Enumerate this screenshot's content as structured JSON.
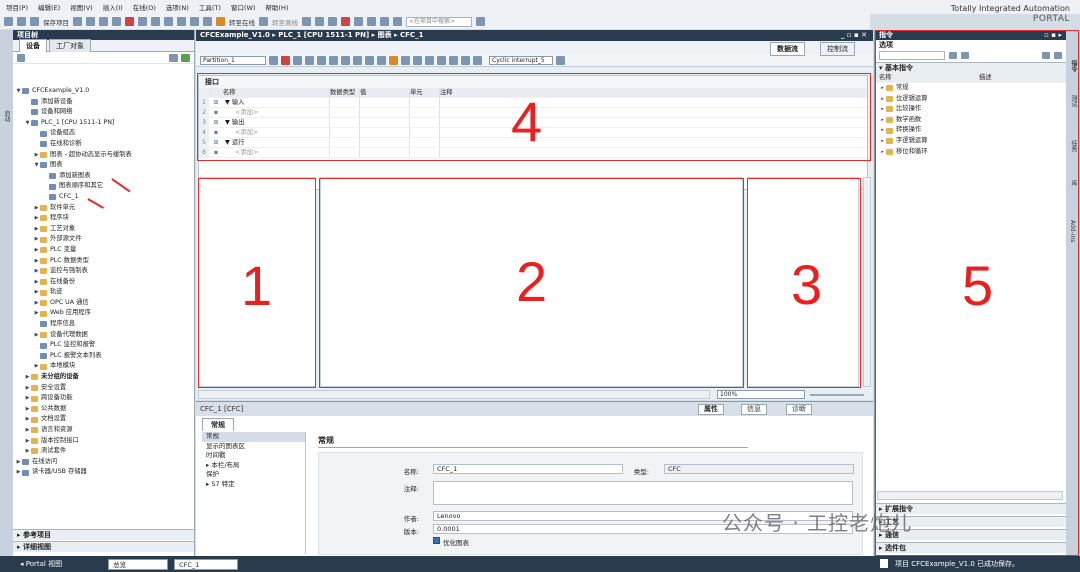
{
  "menu": [
    "项目(P)",
    "编辑(E)",
    "视图(V)",
    "插入(I)",
    "在线(O)",
    "选项(N)",
    "工具(T)",
    "窗口(W)",
    "帮助(H)"
  ],
  "brand": {
    "line1": "Totally Integrated Automation",
    "line2": "PORTAL"
  },
  "toolbar": {
    "save": "保存项目",
    "go_online": "转至在线",
    "go_offline": "转至离线",
    "search_placeholder": "<在项目中搜索>"
  },
  "project_tree": {
    "title": "项目树",
    "tabs": [
      "设备",
      "工厂对象"
    ],
    "side_label": "启动",
    "items": [
      {
        "label": "CFCExample_V1.0",
        "indent": 0,
        "expand": "▼"
      },
      {
        "label": "添加新设备",
        "indent": 1,
        "expand": ""
      },
      {
        "label": "设备和网络",
        "indent": 1,
        "expand": ""
      },
      {
        "label": "PLC_1 [CPU 1511-1 PN]",
        "indent": 1,
        "expand": "▼",
        "sel": true
      },
      {
        "label": "设备组态",
        "indent": 2,
        "expand": ""
      },
      {
        "label": "在线和诊断",
        "indent": 2,
        "expand": ""
      },
      {
        "label": "图表 - 超协动态显示与缓制表",
        "indent": 2,
        "expand": "▶"
      },
      {
        "label": "图表",
        "indent": 2,
        "expand": "▼"
      },
      {
        "label": "添加新图表",
        "indent": 3,
        "expand": ""
      },
      {
        "label": "图表顺序和其它",
        "indent": 3,
        "expand": ""
      },
      {
        "label": "CFC_1",
        "indent": 3,
        "expand": "",
        "sel": true
      },
      {
        "label": "软件单元",
        "indent": 2,
        "expand": "▶"
      },
      {
        "label": "程序块",
        "indent": 2,
        "expand": "▶"
      },
      {
        "label": "工艺对象",
        "indent": 2,
        "expand": "▶"
      },
      {
        "label": "外部源文件",
        "indent": 2,
        "expand": "▶"
      },
      {
        "label": "PLC 变量",
        "indent": 2,
        "expand": "▶"
      },
      {
        "label": "PLC 数据类型",
        "indent": 2,
        "expand": "▶"
      },
      {
        "label": "监控与强制表",
        "indent": 2,
        "expand": "▶"
      },
      {
        "label": "在线备份",
        "indent": 2,
        "expand": "▶"
      },
      {
        "label": "轨迹",
        "indent": 2,
        "expand": "▶"
      },
      {
        "label": "OPC UA 通信",
        "indent": 2,
        "expand": "▶"
      },
      {
        "label": "Web 应用程序",
        "indent": 2,
        "expand": "▶"
      },
      {
        "label": "程序信息",
        "indent": 2,
        "expand": ""
      },
      {
        "label": "设备代理数据",
        "indent": 2,
        "expand": "▶"
      },
      {
        "label": "PLC 监控和报警",
        "indent": 2,
        "expand": ""
      },
      {
        "label": "PLC 报警文本列表",
        "indent": 2,
        "expand": ""
      },
      {
        "label": "本地模块",
        "indent": 2,
        "expand": "▶"
      },
      {
        "label": "未分组的设备",
        "indent": 1,
        "expand": "▶",
        "bold": true
      },
      {
        "label": "安全设置",
        "indent": 1,
        "expand": "▶"
      },
      {
        "label": "跨设备功能",
        "indent": 1,
        "expand": "▶"
      },
      {
        "label": "公共数据",
        "indent": 1,
        "expand": "▶"
      },
      {
        "label": "文档设置",
        "indent": 1,
        "expand": "▶"
      },
      {
        "label": "语言和资源",
        "indent": 1,
        "expand": "▶"
      },
      {
        "label": "版本控制接口",
        "indent": 1,
        "expand": "▶"
      },
      {
        "label": "测试套件",
        "indent": 1,
        "expand": "▶"
      },
      {
        "label": "在线访问",
        "indent": 0,
        "expand": "▶"
      },
      {
        "label": "读卡器/USB 存储器",
        "indent": 0,
        "expand": "▶"
      }
    ],
    "ref_projects": "参考项目",
    "detail_view": "详细视图"
  },
  "editor": {
    "breadcrumb": "CFCExample_V1.0 ▸ PLC_1 [CPU 1511-1 PN] ▸ 图表 ▸ CFC_1",
    "view_tabs": [
      "数据流",
      "控制流"
    ],
    "partition": "Partition_1",
    "cyclic": "Cyclic interrupt_5",
    "interface_title": "接口",
    "columns": [
      "名称",
      "数据类型",
      "值",
      "单元",
      "注释"
    ],
    "rows": [
      {
        "num": "1",
        "name": "▼ 输入",
        "ph": false
      },
      {
        "num": "2",
        "name": "<添加>",
        "ph": true
      },
      {
        "num": "3",
        "name": "▼ 输出",
        "ph": false
      },
      {
        "num": "4",
        "name": "<添加>",
        "ph": true
      },
      {
        "num": "5",
        "name": "▼ 运行",
        "ph": false
      },
      {
        "num": "6",
        "name": "<添加>",
        "ph": true
      }
    ],
    "zoom": "100%"
  },
  "annotations": [
    "1",
    "2",
    "3",
    "4",
    "5"
  ],
  "properties": {
    "title": "CFC_1 [CFC]",
    "tabs": [
      "属性",
      "信息",
      "诊断"
    ],
    "main_tab": "常规",
    "nav": [
      "常规",
      "显示的图表区",
      "时间戳",
      "▸ 本栏/布局",
      "保护",
      "▸ S7 特定"
    ],
    "section": "常规",
    "name_label": "名称:",
    "name_value": "CFC_1",
    "type_label": "类型:",
    "type_value": "CFC",
    "comment_label": "注释:",
    "author_label": "作者:",
    "author_value": "Lenovo",
    "version_label": "版本:",
    "version_value": "0.0001",
    "optimized_label": "优化图表"
  },
  "instructions": {
    "title": "指令",
    "options": "选项",
    "basic": "基本指令",
    "col_name": "名称",
    "col_desc": "描述",
    "items": [
      "常规",
      "位逻辑运算",
      "比较操作",
      "数学函数",
      "转换操作",
      "字逻辑运算",
      "移位和循环"
    ],
    "extended": "扩展指令",
    "tech": "工艺",
    "comm": "通信",
    "packages": "选件包",
    "side_tabs": [
      "指令",
      "测试",
      "任务",
      "库",
      "Add-ins"
    ]
  },
  "status": {
    "portal": "Portal 视图",
    "overview": "总览",
    "open_tab": "CFC_1",
    "message": "项目 CFCExample_V1.0 已成功保存。"
  },
  "watermark": "公众号 · 工控老炮儿"
}
